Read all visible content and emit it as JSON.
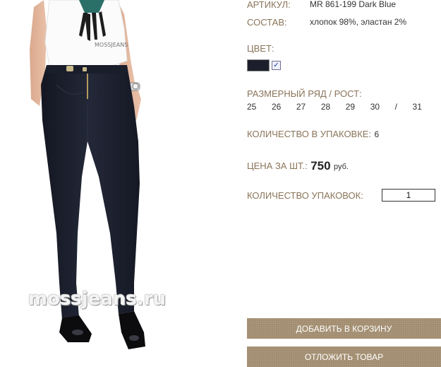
{
  "product": {
    "article_label": "АРТИКУЛ:",
    "article_value": "MR 861-199 Dark Blue",
    "composition_label": "СОСТАВ:",
    "composition_value": "хлопок 98%, эластан 2%",
    "color_label": "ЦВЕТ:",
    "color_swatch": "#1c1f2b",
    "color_selected": true,
    "size_label": "РАЗМЕРНЫЙ РЯД / РОСТ:",
    "sizes": [
      "25",
      "26",
      "27",
      "28",
      "29",
      "30",
      "/",
      "31"
    ],
    "pack_qty_label": "КОЛИЧЕСТВО В УПАКОВКЕ:",
    "pack_qty_value": "6",
    "price_label": "ЦЕНА ЗА ШТ.:",
    "price_value": "750",
    "price_unit": "руб.",
    "packs_label": "КОЛИЧЕСТВО УПАКОВОК:",
    "packs_value": "1"
  },
  "buttons": {
    "add_to_cart": "ДОБАВИТЬ В КОРЗИНУ",
    "postpone": "ОТЛОЖИТЬ ТОВАР"
  },
  "photo": {
    "watermark": "mossjeans.ru"
  },
  "colors": {
    "label_brown": "#8a7459",
    "button_brown": "#a08a6c",
    "jeans_navy": "#1c1f2b"
  }
}
